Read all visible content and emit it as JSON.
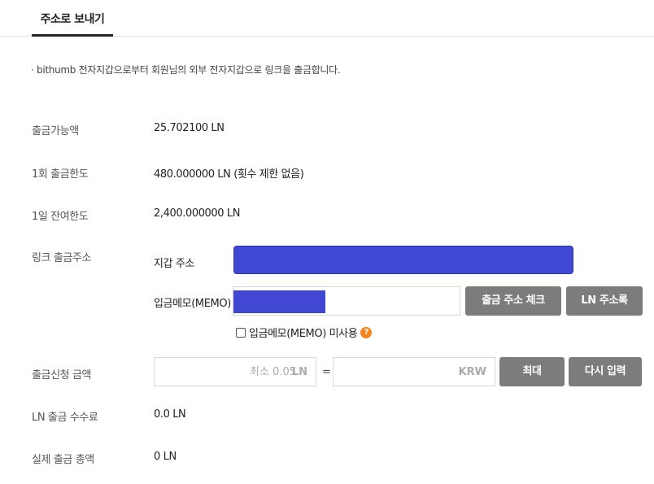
{
  "tabs": {
    "active_label": "주소로 보내기"
  },
  "notice": "· bithumb 전자지갑으로부터 회원님의 외부 전자지갑으로 링크을 출금합니다.",
  "rows": {
    "available": {
      "label": "출금가능액",
      "value": "25.702100 LN"
    },
    "per_tx_limit": {
      "label": "1회 출금한도",
      "value": "480.000000 LN (횟수 제한 없음)"
    },
    "daily_remaining": {
      "label": "1일 잔여한도",
      "value": "2,400.000000 LN"
    },
    "address": {
      "label": "링크 출금주소",
      "wallet_label": "지갑 주소",
      "memo_label": "입금메모(MEMO)",
      "check_button": "출금 주소 체크",
      "addressbook_button": "LN 주소록",
      "no_memo_checkbox": "입금메모(MEMO) 미사용",
      "help_icon": "?"
    },
    "request_amount": {
      "label": "출금신청 금액",
      "amount_placeholder": "최소 0.05",
      "amount_unit": "LN",
      "equals": "=",
      "krw_unit": "KRW",
      "max_button": "최대",
      "reset_button": "다시 입력"
    },
    "fee": {
      "label": "LN 출금 수수료",
      "value": "0.0 LN"
    },
    "total": {
      "label": "실제 출금 총액",
      "value": "0 LN"
    }
  },
  "colors": {
    "accent_fill": "#3f47d3",
    "button_gray": "#7c7c7c",
    "help_orange": "#f5831f"
  }
}
